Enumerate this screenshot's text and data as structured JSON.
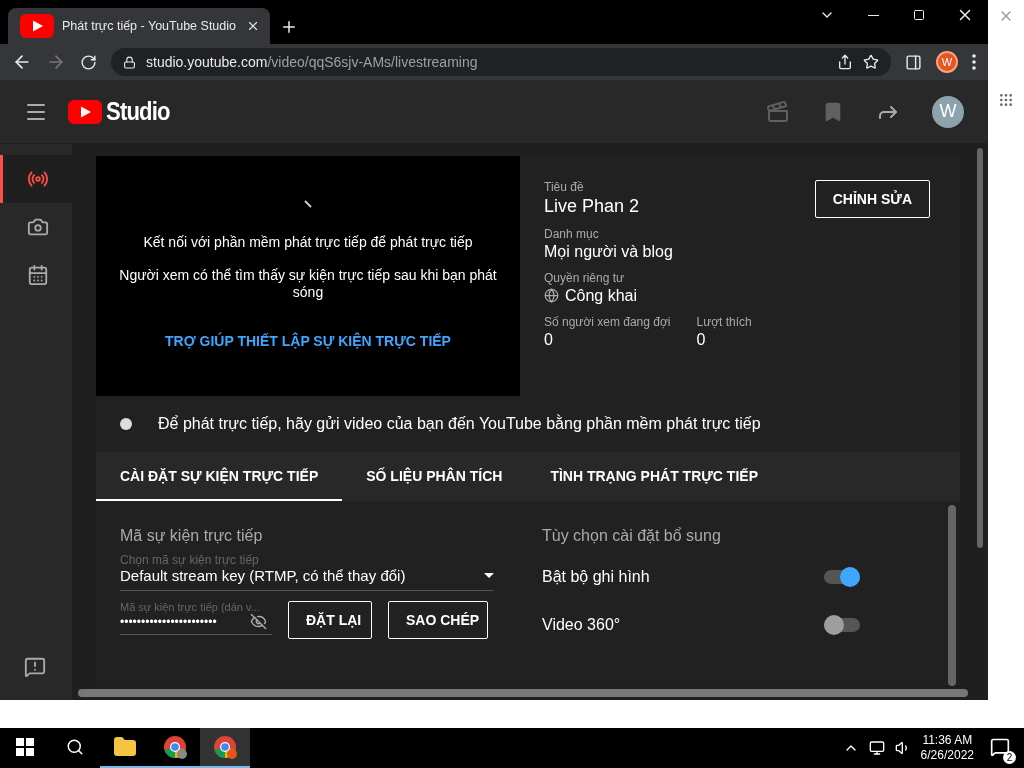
{
  "browser": {
    "tabs": [
      {
        "title": "Phát trực tiếp - YouTube Studio",
        "selected": true
      }
    ],
    "url_host": "studio.youtube.com",
    "url_path": "/video/qqS6sjv-AMs/livestreaming",
    "profile_initial": "W"
  },
  "studio": {
    "logo_text": "Studio",
    "avatar_initial": "W",
    "nav": [
      {
        "kind": "live",
        "selected": true
      },
      {
        "kind": "camera",
        "selected": false
      },
      {
        "kind": "calendar",
        "selected": false
      }
    ]
  },
  "preview": {
    "messages": [
      "Kết nối với phần mềm phát trực tiếp để phát trực tiếp",
      "Người xem có thể tìm thấy sự kiện trực tiếp sau khi bạn phát sóng"
    ],
    "help_link": "TRỢ GIÚP THIẾT LẬP SỰ KIỆN TRỰC TIẾP"
  },
  "details": {
    "fields": [
      {
        "kind": "title",
        "label": "Tiêu đề",
        "value": "Live Phan 2"
      },
      {
        "kind": "plain",
        "label": "Danh mục",
        "value": "Mọi người và blog"
      },
      {
        "kind": "privacy",
        "label": "Quyền riêng tư",
        "value": "Công khai"
      }
    ],
    "stats": [
      {
        "label": "Số người xem đang đợi",
        "value": "0"
      },
      {
        "label": "Lượt thích",
        "value": "0"
      }
    ],
    "edit_button": "CHỈNH SỬA"
  },
  "status_text": "Để phát trực tiếp, hãy gửi video của bạn đến YouTube bằng phần mềm phát trực tiếp",
  "tabs": [
    {
      "label": "CÀI ĐẶT SỰ KIỆN TRỰC TIẾP",
      "selected": true
    },
    {
      "label": "SỐ LIỆU PHÂN TÍCH",
      "selected": false
    },
    {
      "label": "TÌNH TRẠNG PHÁT TRỰC TIẾP",
      "selected": false
    }
  ],
  "stream_key": {
    "heading": "Mã sự kiện trực tiếp",
    "select_label": "Chọn mã sự kiện trực tiếp",
    "select_value": "Default stream key (RTMP, có thể thay đổi)",
    "key_label": "Mã sự kiện trực tiếp (dán v...",
    "key_value": "•••••••••••••••••••••••",
    "buttons": [
      "ĐẶT LẠI",
      "SAO CHÉP"
    ]
  },
  "additional": {
    "heading": "Tùy chọn cài đặt bổ sung",
    "toggles": [
      {
        "label": "Bật bộ ghi hình",
        "on": true
      },
      {
        "label": "Video 360°",
        "on": false
      }
    ]
  },
  "taskbar": {
    "apps": [
      {
        "kind": "explorer",
        "active": false
      },
      {
        "kind": "chrome",
        "active": false
      },
      {
        "kind": "chrome-w",
        "active": true
      }
    ],
    "time": "11:36 AM",
    "date": "6/26/2022",
    "notification_count": "2"
  }
}
